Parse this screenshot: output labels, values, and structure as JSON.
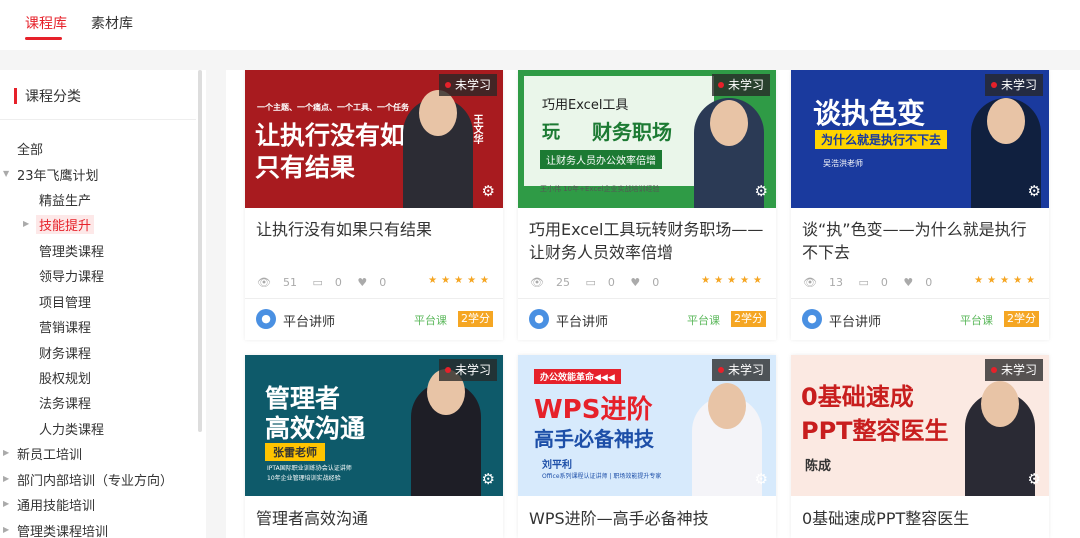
{
  "tabs": [
    {
      "label": "课程库",
      "active": true
    },
    {
      "label": "素材库",
      "active": false
    }
  ],
  "sidebar": {
    "title": "课程分类",
    "items": [
      {
        "label": "全部"
      },
      {
        "label": "23年飞鹰计划"
      },
      {
        "label": "精益生产"
      },
      {
        "label": "技能提升"
      },
      {
        "label": "管理类课程"
      },
      {
        "label": "领导力课程"
      },
      {
        "label": "项目管理"
      },
      {
        "label": "营销课程"
      },
      {
        "label": "财务课程"
      },
      {
        "label": "股权规划"
      },
      {
        "label": "法务课程"
      },
      {
        "label": "人力类课程"
      },
      {
        "label": "新员工培训"
      },
      {
        "label": "部门内部培训（专业方向）"
      },
      {
        "label": "通用技能培训"
      },
      {
        "label": "管理类课程培训"
      }
    ]
  },
  "status_badge": "未学习",
  "courses": [
    {
      "title": "让执行没有如果只有结果",
      "views": "51",
      "comments": "0",
      "likes": "0",
      "lecturer": "平台讲师",
      "type": "平台课",
      "credit": "2学分",
      "thumb_texts": [
        "让执行没有如果",
        "只有结果",
        "一个主题、一个痛点、一个工具、一个任务",
        "王文华"
      ],
      "thumb_bg": "#a81b1f"
    },
    {
      "title": "巧用Excel工具玩转财务职场——让财务人员效率倍增",
      "views": "25",
      "comments": "0",
      "likes": "0",
      "lecturer": "平台讲师",
      "type": "平台课",
      "credit": "2学分",
      "thumb_texts": [
        "巧用Excel工具",
        "玩",
        "财务职场",
        "让财务人员办公效率倍增",
        "王小伟 10年+Excel企业实战培训经验"
      ],
      "thumb_bg": "#2f9b46"
    },
    {
      "title": "谈“执”色变——为什么就是执行不下去",
      "views": "13",
      "comments": "0",
      "likes": "0",
      "lecturer": "平台讲师",
      "type": "平台课",
      "credit": "2学分",
      "thumb_texts": [
        "谈执色变",
        "为什么就是执行不下去",
        "吴浩洪老师"
      ],
      "thumb_bg": "#1a3a9e"
    },
    {
      "title": "管理者高效沟通",
      "thumb_texts": [
        "管理者",
        "高效沟通",
        "张雷老师",
        "IPTA国际职业训练协会认证讲师",
        "10年企业管理培训实战经验"
      ],
      "thumb_bg": "#0e5a6a"
    },
    {
      "title": "WPS进阶—高手必备神技",
      "thumb_texts": [
        "办公效能革命◀◀◀",
        "WPS进阶",
        "高手必备神技",
        "刘平利",
        "Office系列课程认证讲师 | 职场效能提升专家"
      ],
      "thumb_bg": "#d7eafc"
    },
    {
      "title": "0基础速成PPT整容医生",
      "thumb_texts": [
        "0基础速成",
        "PPT整容医生",
        "陈成"
      ],
      "thumb_bg": "#fbe9e2"
    }
  ]
}
